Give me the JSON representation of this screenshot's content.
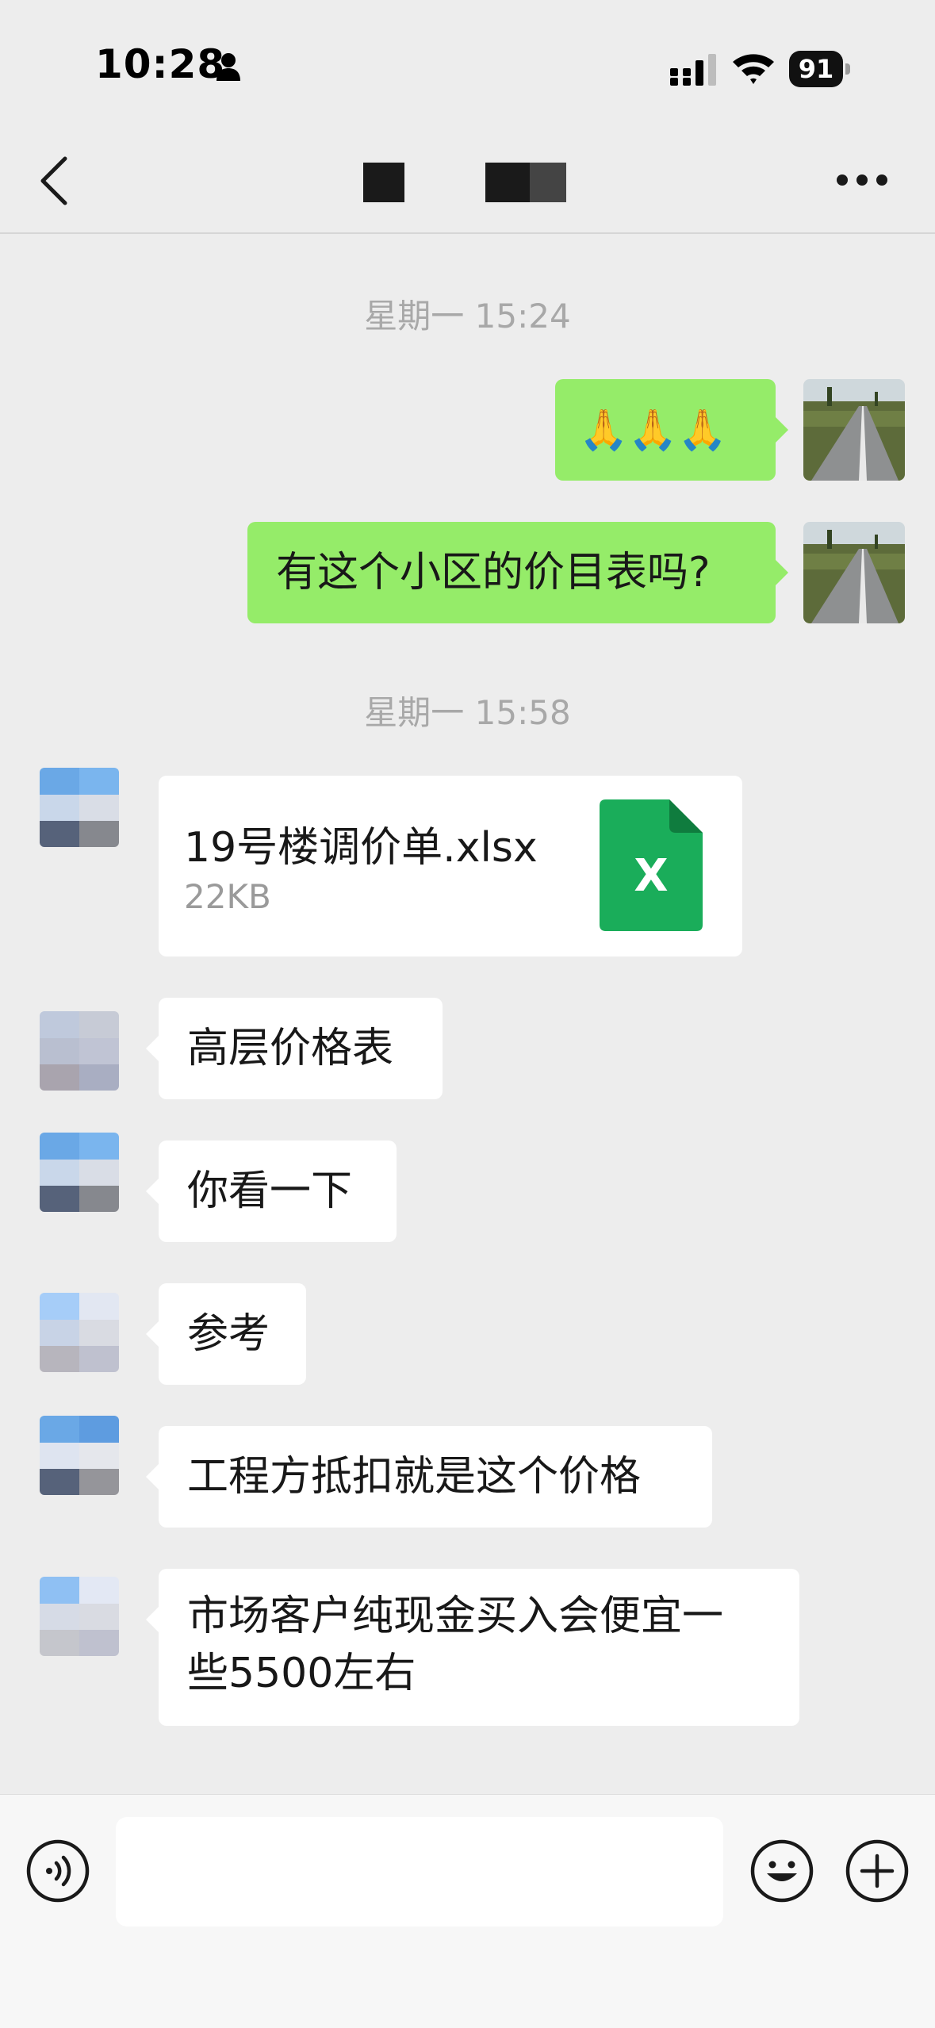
{
  "status_bar": {
    "time": "10:28",
    "battery": "91",
    "icons": [
      "person-icon",
      "signal-icon",
      "wifi-icon",
      "battery-icon"
    ]
  },
  "nav": {
    "back_icon": "chevron-left-icon",
    "more_icon": "more-dots-icon"
  },
  "messages": {
    "ts1": "星期一 15:24",
    "sent1": "🙏🙏🙏",
    "sent2": "有这个小区的价目表吗?",
    "ts2": "星期一 15:58",
    "file": {
      "name": "19号楼调价单.xlsx",
      "size": "22KB",
      "icon_label": "X"
    },
    "recv2": "高层价格表",
    "recv3": "你看一下",
    "recv4": "参考",
    "recv5": "工程方抵扣就是这个价格",
    "recv6_line1": "市场客户纯现金买入会便宜一",
    "recv6_line2": "些5500左右"
  },
  "input_bar": {
    "input_value": "",
    "icons": [
      "voice-icon",
      "emoji-icon",
      "plus-icon"
    ]
  },
  "colors": {
    "background": "#ededed",
    "sent_bubble": "#95ec69",
    "received_bubble": "#ffffff",
    "excel_green": "#1aad5a"
  }
}
